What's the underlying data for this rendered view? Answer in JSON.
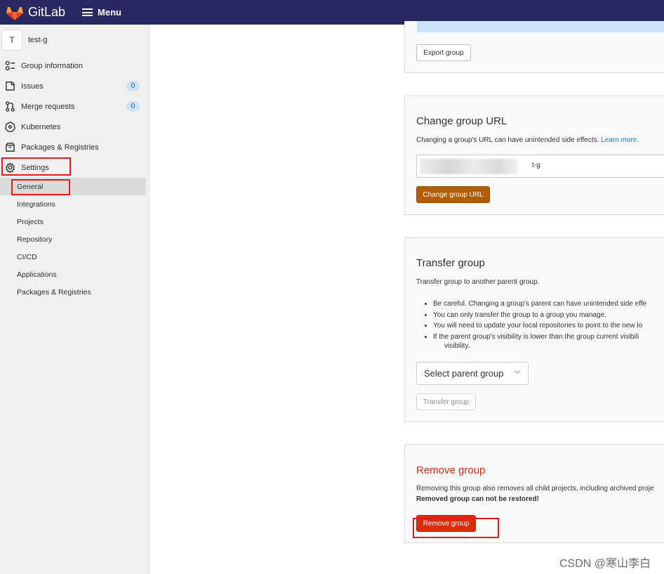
{
  "topbar": {
    "brand": "GitLab",
    "menu_label": "Menu"
  },
  "sidebar": {
    "context": {
      "avatar_letter": "T",
      "name": "test-g"
    },
    "items": [
      {
        "label": "Group information",
        "icon": "group-icon"
      },
      {
        "label": "Issues",
        "icon": "issues-icon",
        "badge": "0"
      },
      {
        "label": "Merge requests",
        "icon": "merge-request-icon",
        "badge": "0"
      },
      {
        "label": "Kubernetes",
        "icon": "kubernetes-icon"
      },
      {
        "label": "Packages & Registries",
        "icon": "package-icon"
      },
      {
        "label": "Settings",
        "icon": "settings-gear-icon"
      }
    ],
    "settings_sub": [
      "General",
      "Integrations",
      "Projects",
      "Repository",
      "CI/CD",
      "Applications",
      "Packages & Registries"
    ]
  },
  "export": {
    "button": "Export group"
  },
  "change_url": {
    "title": "Change group URL",
    "desc": "Changing a group's URL can have unintended side effects.",
    "learn_more": "Learn more.",
    "input_suffix": "t-g",
    "button": "Change group URL"
  },
  "transfer": {
    "title": "Transfer group",
    "desc": "Transfer group to another parent group.",
    "bullets": [
      "Be careful. Changing a group's parent can have unintended side effe",
      "You can only transfer the group to a group you manage.",
      "You will need to update your local repositories to point to the new lo",
      "If the parent group's visibility is lower than the group current visibili"
    ],
    "bullet_cont": "visibility.",
    "select_placeholder": "Select parent group",
    "button": "Transfer group"
  },
  "remove": {
    "title": "Remove group",
    "desc": "Removing this group also removes all child projects, including archived proje",
    "warning": "Removed group can not be restored!",
    "button": "Remove group"
  },
  "colors": {
    "topbar": "#292961",
    "primary_warning": "#b25d00",
    "danger": "#dd2b0e",
    "annotation": "#e41b1b"
  },
  "watermark": "CSDN @寒山李白"
}
